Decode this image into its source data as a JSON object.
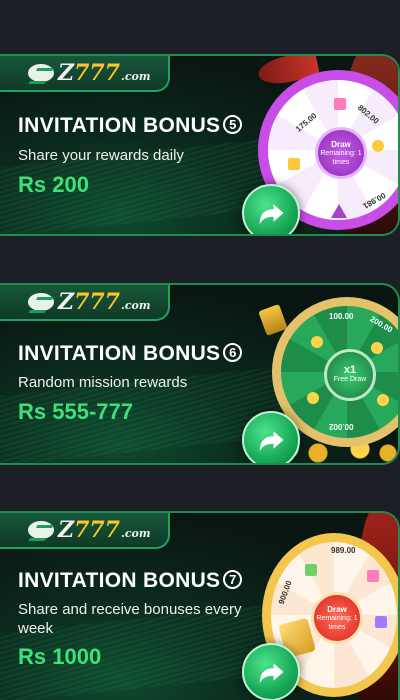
{
  "cards": [
    {
      "logo": {
        "z": "Z",
        "sevens": "777",
        "dom": ".com"
      },
      "title": "INVITATION BONUS",
      "badge": "5",
      "subtitle": "Share your rewards daily",
      "amount": "Rs 200",
      "wheel": {
        "style": "purple",
        "hub_title": "Draw",
        "hub_sub": "Remaining: 1 times",
        "labels": [
          "175.00",
          "802.00",
          "00.981"
        ]
      }
    },
    {
      "logo": {
        "z": "Z",
        "sevens": "777",
        "dom": ".com"
      },
      "title": "INVITATION BONUS",
      "badge": "6",
      "subtitle": "Random mission rewards",
      "amount": "Rs 555-777",
      "wheel": {
        "style": "green",
        "hub_title": "x1",
        "hub_sub": "Free Draw",
        "labels": [
          "100.00",
          "200.00",
          "00.002"
        ]
      }
    },
    {
      "logo": {
        "z": "Z",
        "sevens": "777",
        "dom": ".com"
      },
      "title": "INVITATION BONUS",
      "badge": "7",
      "subtitle": "Share and receive bonuses every week",
      "amount": "Rs 1000",
      "wheel": {
        "style": "red",
        "hub_title": "Draw",
        "hub_sub": "Remaining: 1 times",
        "labels": [
          "989.00",
          "900.00"
        ]
      }
    }
  ],
  "icons": {
    "share": "share-arrow-icon",
    "logo": "z777-logo-icon"
  }
}
